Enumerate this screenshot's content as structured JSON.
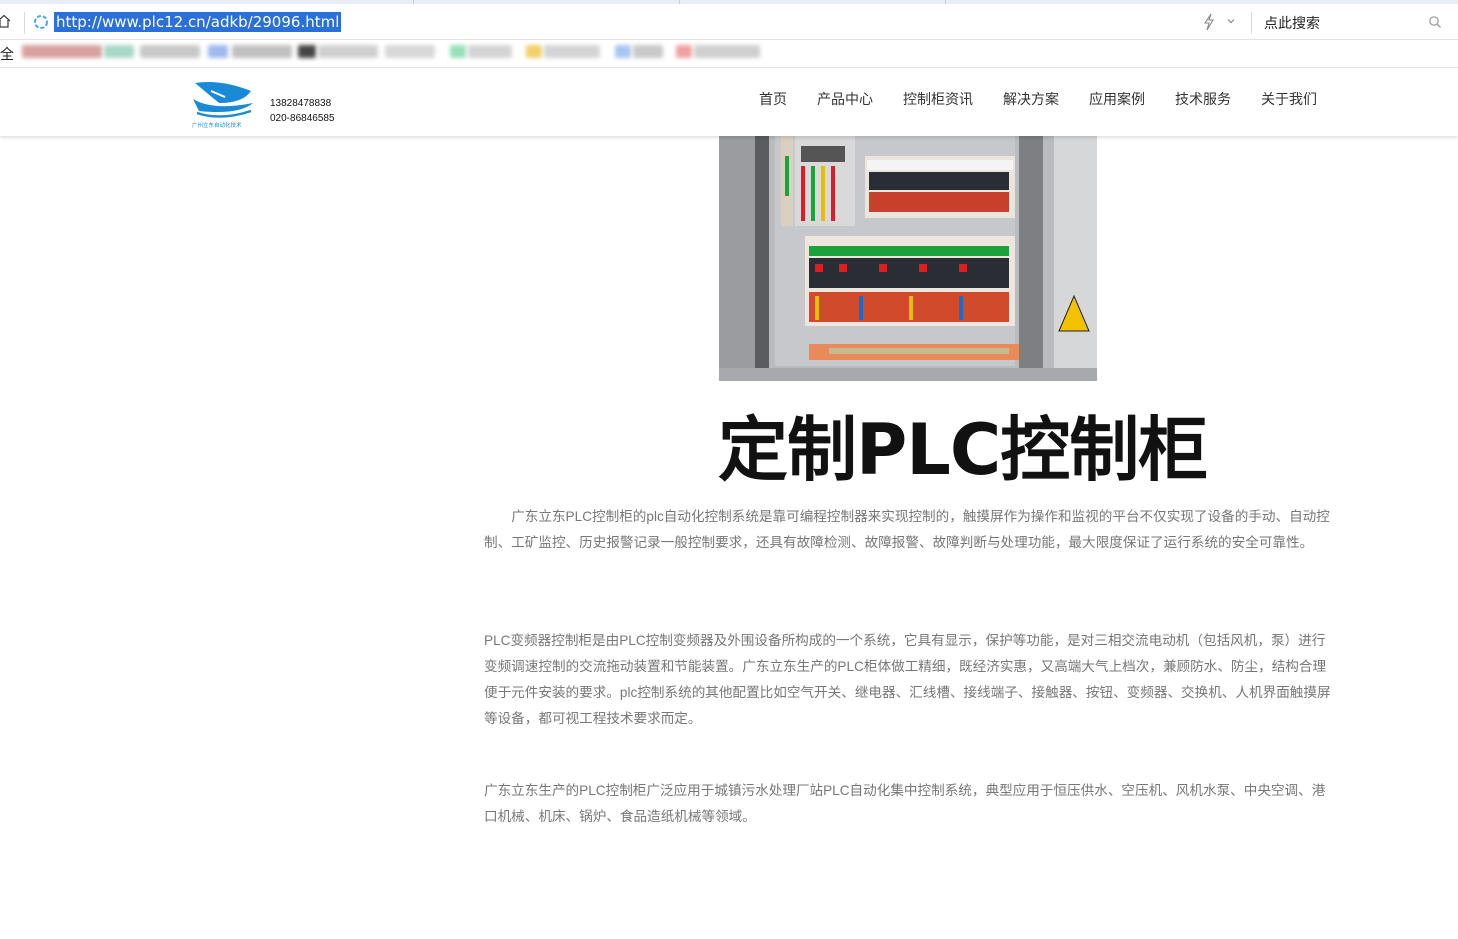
{
  "browser": {
    "url": "http://www.plc12.cn/adkb/29096.html",
    "search_placeholder": "点此搜索",
    "bookmarks_first_label": "全",
    "icons": [
      "home-icon",
      "loading-icon",
      "flash-icon",
      "chevron-down-icon",
      "search-icon"
    ]
  },
  "site": {
    "phone_1": "13828478838",
    "phone_2": "020-86846585",
    "logo_icon": "company-logo-icon",
    "nav": [
      "首页",
      "产品中心",
      "控制柜资讯",
      "解决方案",
      "应用案例",
      "技术服务",
      "关于我们"
    ]
  },
  "article": {
    "banner_title": "定制PLC控制柜",
    "paragraphs": [
      "广东立东PLC控制柜的plc自动化控制系统是靠可编程控制器来实现控制的，触摸屏作为操作和监视的平台不仅实现了设备的手动、自动控制、工矿监控、历史报警记录一般控制要求，还具有故障检测、故障报警、故障判断与处理功能，最大限度保证了运行系统的安全可靠性。",
      "PLC变频器控制柜是由PLC控制变频器及外围设备所构成的一个系统，它具有显示，保护等功能，是对三相交流电动机（包括风机，泵）进行变频调速控制的交流拖动装置和节能装置。广东立东生产的PLC柜体做工精细，既经济实惠，又高端大气上档次，兼顾防水、防尘，结构合理便于元件安装的要求。plc控制系统的其他配置比如空气开关、继电器、汇线槽、接线端子、接触器、按钮、变频器、交换机、人机界面触摸屏等设备，都可视工程技术要求而定。",
      "广东立东生产的PLC控制柜广泛应用于城镇污水处理厂站PLC自动化集中控制系统，典型应用于恒压供水、空压机、风机水泵、中央空调、港口机械、机床、锅炉、食品造纸机械等领域。"
    ]
  },
  "colors": {
    "url_highlight": "#2b70d8",
    "logo_blue": "#1a8ad6",
    "body_text": "#777777"
  }
}
